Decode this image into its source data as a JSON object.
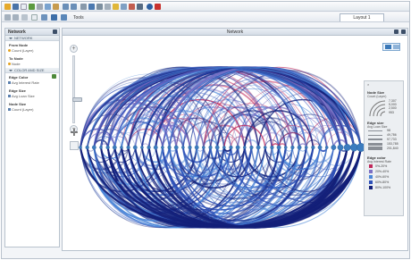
{
  "toolbar": {
    "tools_label": "Tools",
    "layout_tab": "Layout 1"
  },
  "left_panel": {
    "title": "Network",
    "sections": [
      {
        "header": "NETWORK",
        "groups": [
          {
            "label": "From Node",
            "value": "Count (Layer)",
            "icon": "node-icon"
          },
          {
            "label": "To Node",
            "value": "Node",
            "icon": "node-icon"
          }
        ]
      },
      {
        "header": "COLOR AND SIZE",
        "groups": [
          {
            "label": "Edge Color",
            "value": "Avg Interest Rate",
            "icon": "measure-icon"
          },
          {
            "label": "Edge Size",
            "value": "Avg Loan Size",
            "icon": "measure-icon"
          },
          {
            "label": "Node Size",
            "value": "Count (Layer)",
            "icon": "measure-icon"
          }
        ]
      }
    ]
  },
  "network_panel": {
    "title": "Network"
  },
  "legend": {
    "node_size_title": "Node Size",
    "node_size_sub": "Count (Layer)",
    "node_size_values": [
      "7,307",
      "5,000",
      "2,500",
      "953"
    ],
    "edge_size_title": "Edge size",
    "edge_size_sub": "Avg Loan Size",
    "edge_size_values": [
      "98",
      "49,786",
      "97,733",
      "153,785",
      "201,840"
    ],
    "edge_color_title": "Edge color",
    "edge_color_sub": "Avg Interest Rate",
    "edge_color_items": [
      {
        "label": "0%-20%",
        "color": "#c0285a"
      },
      {
        "label": "20%-40%",
        "color": "#7c6fc4"
      },
      {
        "label": "40%-60%",
        "color": "#4a86d8"
      },
      {
        "label": "60%-80%",
        "color": "#2d50b8"
      },
      {
        "label": "80%-100%",
        "color": "#13207a"
      }
    ]
  },
  "colors": {
    "node": "#3b7cbf",
    "edge_red": "#c0285a",
    "edge_blue": "#2d50b8",
    "edge_dark": "#13207a"
  }
}
